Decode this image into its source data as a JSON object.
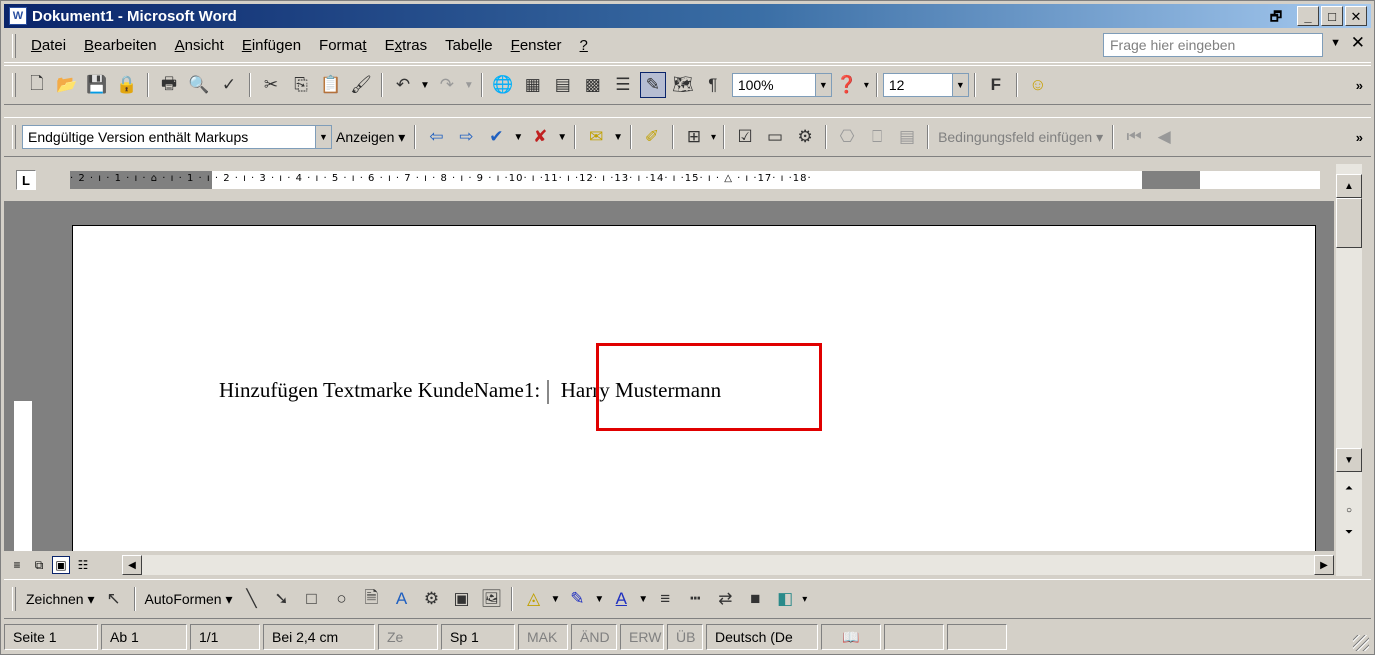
{
  "window": {
    "title": "Dokument1 - Microsoft Word",
    "controls": {
      "restore": "🗗",
      "minimize": "_",
      "maximize": "□",
      "close": "✕"
    }
  },
  "menubar": {
    "items": [
      {
        "pre": "",
        "u": "D",
        "post": "atei"
      },
      {
        "pre": "",
        "u": "B",
        "post": "earbeiten"
      },
      {
        "pre": "",
        "u": "A",
        "post": "nsicht"
      },
      {
        "pre": "",
        "u": "E",
        "post": "infügen"
      },
      {
        "pre": "Forma",
        "u": "t",
        "post": ""
      },
      {
        "pre": "E",
        "u": "x",
        "post": "tras"
      },
      {
        "pre": "Tabe",
        "u": "l",
        "post": "le"
      },
      {
        "pre": "",
        "u": "F",
        "post": "enster"
      },
      {
        "pre": "",
        "u": "?",
        "post": ""
      }
    ],
    "help_placeholder": "Frage hier eingeben"
  },
  "standard_toolbar": {
    "zoom": "100%",
    "font_size": "12",
    "bold": "F"
  },
  "review_toolbar": {
    "display_mode": "Endgültige Version enthält Markups",
    "show_label": "Anzeigen",
    "field_label": "Bedingungsfeld einfügen"
  },
  "ruler": {
    "ticks": "· 2 · ı · 1 · ı · ⌂ · ı · 1 · ı · 2 · ı · 3 · ı · 4 · ı · 5 · ı · 6 · ı · 7 · ı · 8 · ı · 9 · ı ·10· ı ·11· ı ·12· ı ·13· ı ·14· ı ·15· ı · △ · ı ·17· ı ·18·"
  },
  "document": {
    "text_before": "Hinzufügen Textmarke KundeName1:",
    "text_after": "Harry Mustermann"
  },
  "drawing_toolbar": {
    "draw_label": "Zeichnen",
    "autoshapes_label": "AutoFormen"
  },
  "statusbar": {
    "page": "Seite 1",
    "section": "Ab 1",
    "pages": "1/1",
    "position": "Bei 2,4 cm",
    "line": "Ze",
    "column": "Sp 1",
    "mak": "MAK",
    "and": "ÄND",
    "erw": "ERW",
    "ub": "ÜB",
    "language": "Deutsch (De"
  }
}
